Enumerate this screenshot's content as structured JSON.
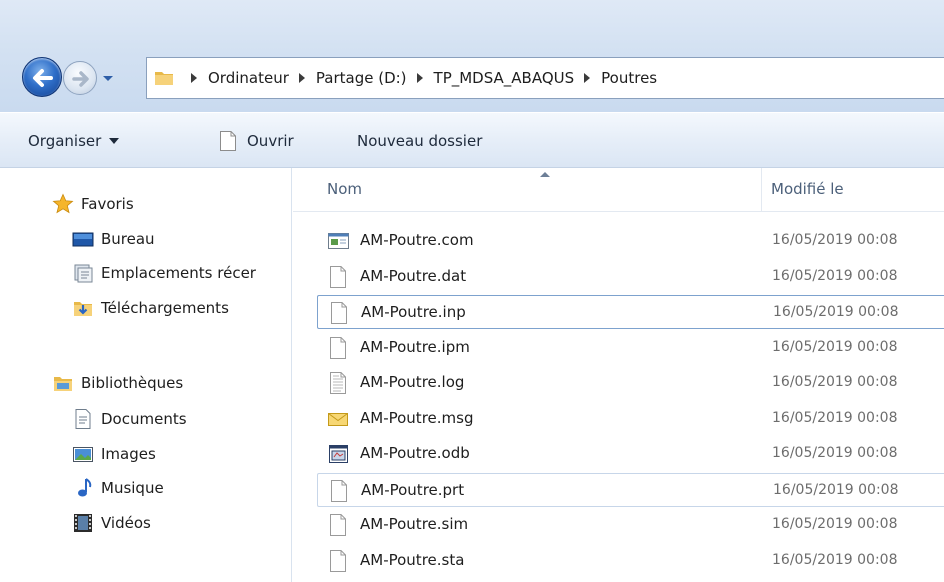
{
  "addressbar": {
    "crumbs": [
      "Ordinateur",
      "Partage (D:)",
      "TP_MDSA_ABAQUS",
      "Poutres"
    ]
  },
  "toolbar": {
    "organiser_label": "Organiser",
    "open_label": "Ouvrir",
    "new_folder_label": "Nouveau dossier"
  },
  "navpane": {
    "favorites_label": "Favoris",
    "favorites": [
      {
        "label": "Bureau",
        "icon": "desktop-icon"
      },
      {
        "label": "Emplacements récer",
        "icon": "recent-places-icon"
      },
      {
        "label": "Téléchargements",
        "icon": "downloads-folder-icon"
      }
    ],
    "libraries_label": "Bibliothèques",
    "libraries": [
      {
        "label": "Documents",
        "icon": "documents-icon"
      },
      {
        "label": "Images",
        "icon": "images-icon"
      },
      {
        "label": "Musique",
        "icon": "music-icon"
      },
      {
        "label": "Vidéos",
        "icon": "videos-icon"
      }
    ]
  },
  "filelist": {
    "columns": {
      "name": "Nom",
      "modified": "Modifié le"
    },
    "files": [
      {
        "name": "AM-Poutre.com",
        "modified": "16/05/2019 00:08",
        "icon": "executable-icon"
      },
      {
        "name": "AM-Poutre.dat",
        "modified": "16/05/2019 00:08",
        "icon": "file-icon"
      },
      {
        "name": "AM-Poutre.inp",
        "modified": "16/05/2019 00:08",
        "icon": "file-icon",
        "state": "selected"
      },
      {
        "name": "AM-Poutre.ipm",
        "modified": "16/05/2019 00:08",
        "icon": "file-icon"
      },
      {
        "name": "AM-Poutre.log",
        "modified": "16/05/2019 00:08",
        "icon": "text-file-icon"
      },
      {
        "name": "AM-Poutre.msg",
        "modified": "16/05/2019 00:08",
        "icon": "mail-icon"
      },
      {
        "name": "AM-Poutre.odb",
        "modified": "16/05/2019 00:08",
        "icon": "odb-icon"
      },
      {
        "name": "AM-Poutre.prt",
        "modified": "16/05/2019 00:08",
        "icon": "file-icon",
        "state": "hover"
      },
      {
        "name": "AM-Poutre.sim",
        "modified": "16/05/2019 00:08",
        "icon": "file-icon"
      },
      {
        "name": "AM-Poutre.sta",
        "modified": "16/05/2019 00:08",
        "icon": "file-icon"
      }
    ]
  },
  "colors": {
    "selection_border": "#7da2ce",
    "hover_border": "#c7d6e9",
    "header_text": "#4c607a",
    "date_text": "#6d6d6d"
  }
}
